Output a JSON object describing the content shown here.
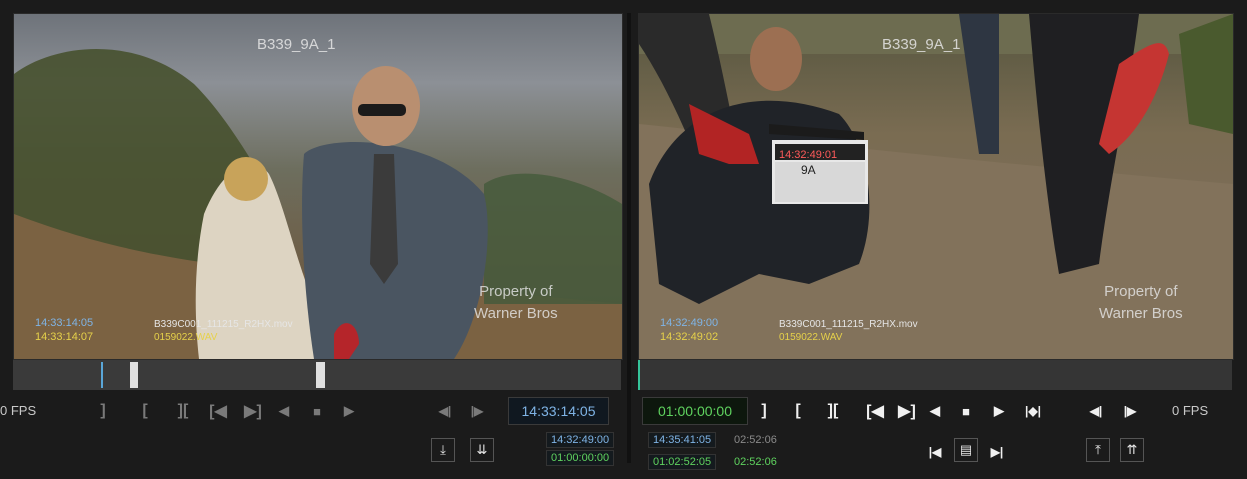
{
  "left_viewer": {
    "clip_name": "B339_9A_1",
    "watermark_line1": "Property of",
    "watermark_line2": "Warner Bros",
    "tc_source": "14:33:14:05",
    "tc_audio": "14:33:14:07",
    "video_file": "B339C001_111215_R2HX.mov",
    "audio_file": "0159022.WAV"
  },
  "right_viewer": {
    "clip_name": "B339_9A_1",
    "watermark_line1": "Property of",
    "watermark_line2": "Warner Bros",
    "tc_source": "14:32:49:00",
    "tc_audio": "14:32:49:02",
    "video_file": "B339C001_111215_R2HX.mov",
    "audio_file": "0159022.WAV",
    "slate_tc": "14:32:49:01",
    "slate_scene": "9A"
  },
  "left_controls": {
    "fps": "0 FPS",
    "timecode": "14:33:14:05",
    "in_tc": "14:32:49:00",
    "out_tc": "01:00:00:00"
  },
  "right_controls": {
    "fps": "0 FPS",
    "timecode": "01:00:00:00",
    "in_tc": "14:35:41:05",
    "duration1": "02:52:06",
    "out_tc": "01:02:52:05",
    "duration2": "02:52:06"
  },
  "colors": {
    "timecode_blue": "#7fb4e6",
    "timecode_yellow": "#e6d14a",
    "timecode_green": "#5fd35f"
  }
}
